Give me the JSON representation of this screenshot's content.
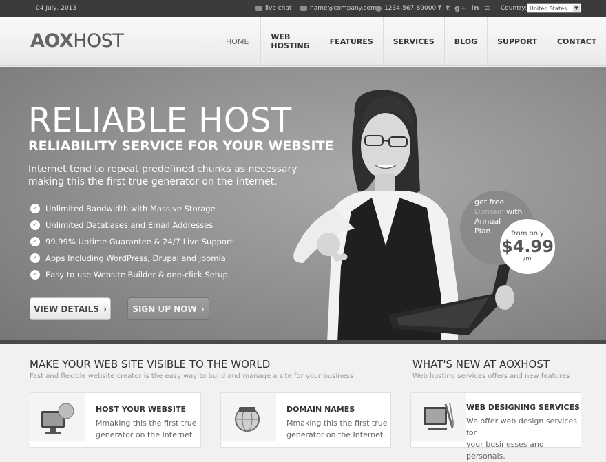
{
  "topbar": {
    "date": "04 July, 2013",
    "live_chat": "live chat",
    "email": "name@company.com",
    "phone": "1234-567-89000",
    "social_icons": [
      "facebook-icon",
      "twitter-icon",
      "google-plus-icon",
      "linkedin-icon",
      "rss-icon"
    ],
    "social_glyphs": [
      "f",
      "t",
      "g+",
      "in",
      "≡"
    ],
    "country_label": "Country:",
    "country_value": "United States"
  },
  "header": {
    "logo_bold": "AOX",
    "logo_light": "HOST",
    "nav": [
      "HOME",
      "WEB HOSTING",
      "FEATURES",
      "SERVICES",
      "BLOG",
      "SUPPORT",
      "CONTACT"
    ]
  },
  "hero": {
    "title": "RELIABLE HOST",
    "subtitle": "RELIABILITY SERVICE FOR YOUR WEBSITE",
    "desc_line1": "Internet tend to repeat predefined chunks as necessary",
    "desc_line2": "making this the first true generator on the internet.",
    "features": [
      "Unlimited Bandwidth with Massive Storage",
      "Unlimited Databases and Email Addresses",
      "99.99% Uptime Guarantee & 24/7 Live Support",
      "Apps Including WordPress, Drupal and Joomla",
      "Easy to use Website Builder & one-click Setup"
    ],
    "view_button": "VIEW DETAILS",
    "signup_button": "SIGN UP NOW",
    "badge": {
      "line1": "get free",
      "highlight": "Domain",
      "line2_rest": " with",
      "line3": "Annual",
      "line4": "Plan",
      "from": "from only",
      "price": "$4.99",
      "per": "/m"
    }
  },
  "content": {
    "left_title": "MAKE YOUR WEB SITE VISIBLE TO THE WORLD",
    "left_sub": "Fast and flexible website creator is the easy way to build and manage a site for your business",
    "right_title": "WHAT'S NEW AT AOXHOST",
    "right_sub": "Web hosting services offers and new features",
    "cards": [
      {
        "title": "HOST YOUR WEBSITE",
        "line1": "Mmaking this the first true",
        "line2": "generator on the Internet."
      },
      {
        "title": "DOMAIN NAMES",
        "line1": "Mmaking this the first true",
        "line2": "generator on the Internet."
      },
      {
        "title": "WEB DESIGNING SERVICES",
        "line1": "We offer web design services for",
        "line2": "your businesses and personals."
      }
    ]
  }
}
